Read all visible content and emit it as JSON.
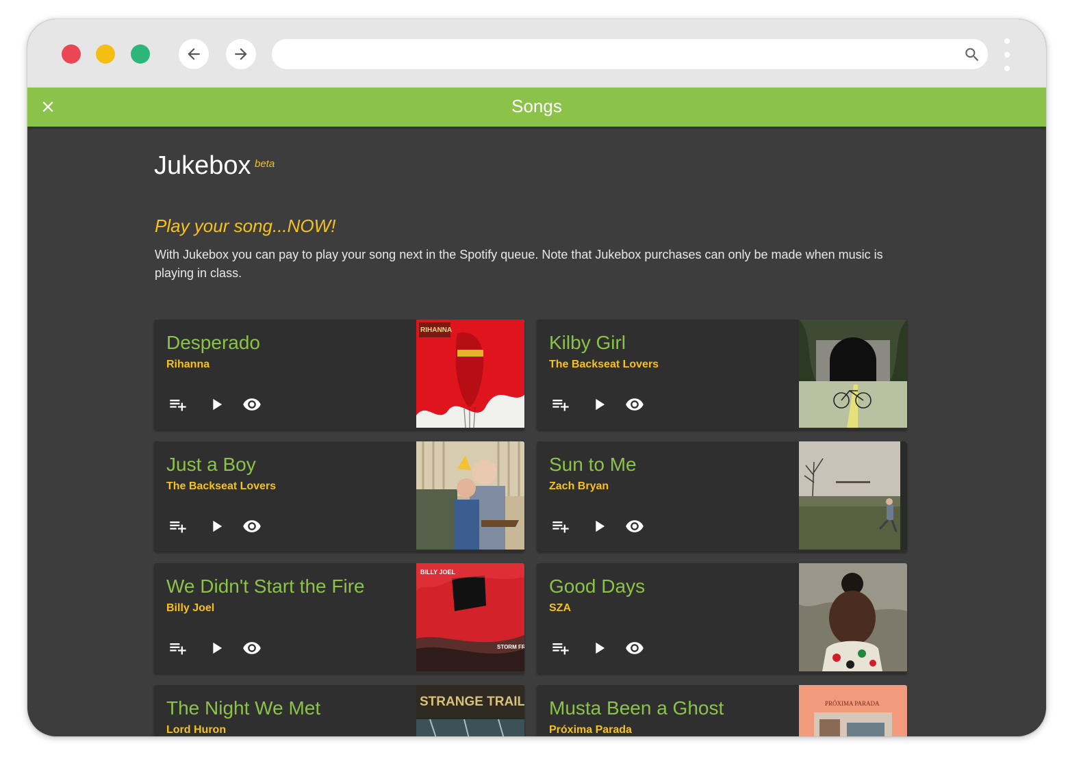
{
  "browser": {
    "url": ""
  },
  "appbar": {
    "title": "Songs"
  },
  "page": {
    "heading": "Jukebox",
    "badge": "beta",
    "tagline": "Play your song...NOW!",
    "description": "With Jukebox you can pay to play your song next in the Spotify queue. Note that Jukebox purchases can only be made when music is playing in class."
  },
  "songs": [
    {
      "title": "Desperado",
      "artist": "Rihanna",
      "art_text": "RIHANNA"
    },
    {
      "title": "Kilby Girl",
      "artist": "The Backseat Lovers"
    },
    {
      "title": "Just a Boy",
      "artist": "The Backseat Lovers"
    },
    {
      "title": "Sun to Me",
      "artist": "Zach Bryan"
    },
    {
      "title": "We Didn't Start the Fire",
      "artist": "Billy Joel",
      "art_text": "BILLY JOEL",
      "art_text_2": "STORM FRONT"
    },
    {
      "title": "Good Days",
      "artist": "SZA"
    },
    {
      "title": "The Night We Met",
      "artist": "Lord Huron",
      "art_text": "STRANGE TRAILS"
    },
    {
      "title": "Musta Been a Ghost",
      "artist": "Próxima Parada",
      "art_text": "PRÓXIMA PARADA"
    }
  ],
  "icons": {
    "queue": "playlist-add-icon",
    "play": "play-icon",
    "view": "eye-icon"
  },
  "colors": {
    "accent_green": "#8bc34a",
    "accent_yellow": "#f5c21c",
    "background": "#3d3d3d",
    "card": "#2f2f2f"
  }
}
